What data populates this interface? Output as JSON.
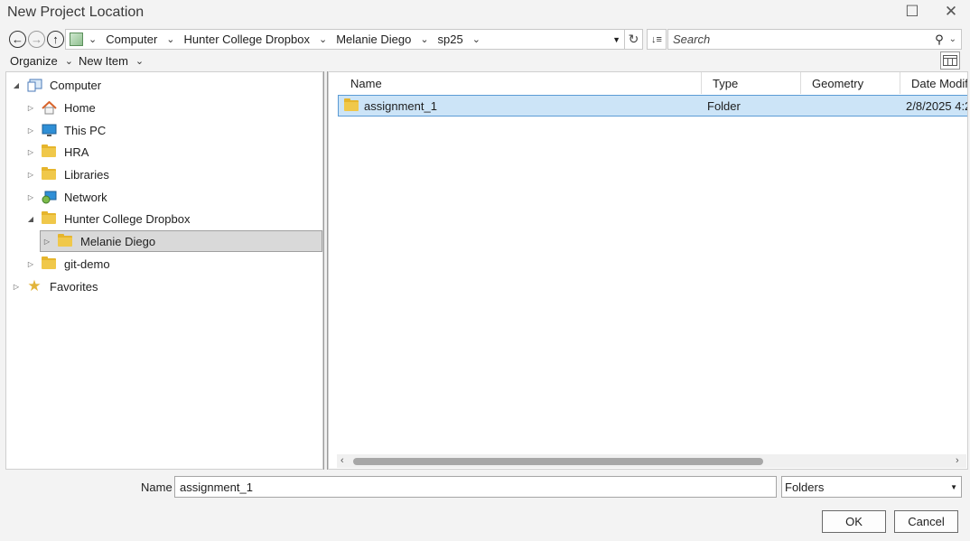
{
  "window": {
    "title": "New Project Location",
    "maximize_icon": "☐",
    "close_icon": "✕"
  },
  "address": {
    "breadcrumbs": [
      "Computer",
      "Hunter College Dropbox",
      "Melanie Diego",
      "sp25"
    ],
    "search_placeholder": "Search"
  },
  "toolbar": {
    "organize_label": "Organize",
    "new_item_label": "New Item"
  },
  "tree": {
    "items": [
      {
        "label": "Computer",
        "icon": "computer-icon",
        "expander": "◢"
      },
      {
        "label": "Home",
        "icon": "home-icon",
        "expander": "▷"
      },
      {
        "label": "This PC",
        "icon": "monitor-icon",
        "expander": "▷"
      },
      {
        "label": "HRA",
        "icon": "folder-icon",
        "expander": "▷"
      },
      {
        "label": "Libraries",
        "icon": "folder-icon",
        "expander": "▷"
      },
      {
        "label": "Network",
        "icon": "network-icon",
        "expander": "▷"
      },
      {
        "label": "Hunter College Dropbox",
        "icon": "folder-icon",
        "expander": "◢"
      },
      {
        "label": "Melanie Diego",
        "icon": "folder-icon",
        "expander": "▷"
      },
      {
        "label": "git-demo",
        "icon": "folder-icon",
        "expander": "▷"
      },
      {
        "label": "Favorites",
        "icon": "star-icon",
        "expander": "▷"
      }
    ]
  },
  "file_list": {
    "columns": [
      "Name",
      "Type",
      "Geometry",
      "Date Modif"
    ],
    "rows": [
      {
        "name": "assignment_1",
        "type": "Folder",
        "geometry": "",
        "date": "2/8/2025 4:2"
      }
    ]
  },
  "bottom": {
    "name_label": "Name",
    "name_value": "assignment_1",
    "filter_value": "Folders",
    "ok_label": "OK",
    "cancel_label": "Cancel"
  },
  "colors": {
    "selection": "#cce4f7",
    "selection_border": "#5b9bd5",
    "tree_selected": "#d9d9d9",
    "folder": "#f0c84a"
  }
}
